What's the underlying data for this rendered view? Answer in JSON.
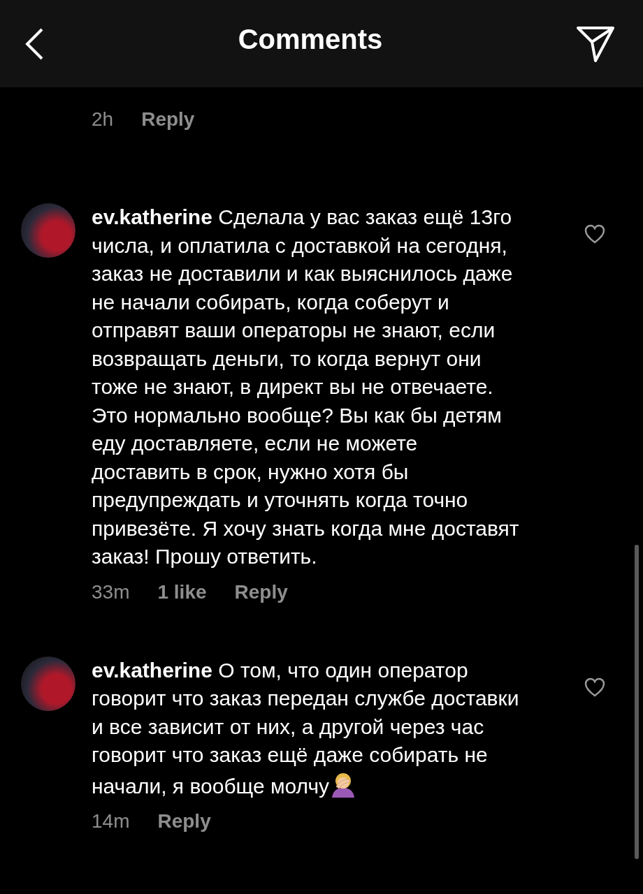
{
  "header": {
    "title": "Comments"
  },
  "partial_comment": {
    "time": "2h",
    "reply": "Reply"
  },
  "comments": [
    {
      "username": "ev.katherine",
      "text": "Сделала у вас заказ ещё 13го числа, и оплатила с доставкой на сегодня, заказ не доставили и как выяснилось даже не начали собирать, когда соберут и отправят ваши операторы не знают, если возвращать деньги, то когда вернут они тоже не знают, в директ вы не отвечаете. Это нормально вообще? Вы как бы детям еду доставляете, если не можете доставить в срок, нужно хотя бы предупреждать и уточнять когда точно привезёте. Я хочу знать когда мне доставят заказ! Прошу ответить.",
      "emoji": false,
      "time": "33m",
      "likes": "1 like",
      "reply": "Reply",
      "liked": false
    },
    {
      "username": "ev.katherine",
      "text": "О том, что один оператор говорит что заказ передан службе доставки и все зависит от них, а другой через час говорит что заказ ещё даже собирать не начали, я вообще молчу",
      "emoji": true,
      "time": "14m",
      "reply": "Reply",
      "liked": false
    }
  ]
}
